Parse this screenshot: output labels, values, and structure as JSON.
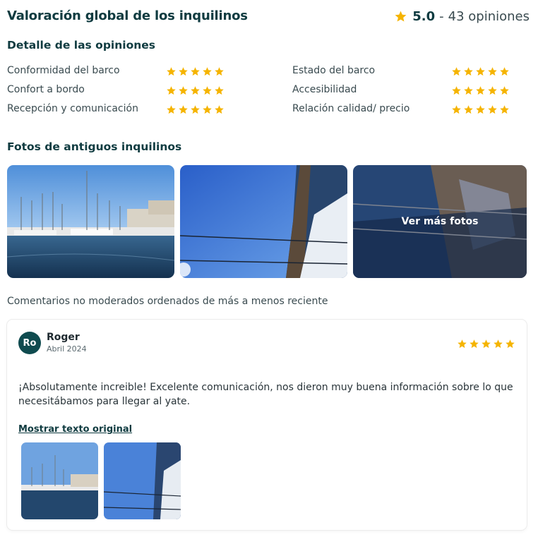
{
  "header": {
    "title": "Valoración global de los inquilinos",
    "score": "5.0",
    "separator": "-",
    "reviews_count": "43 opiniones",
    "star_color": "#f5b400"
  },
  "detail": {
    "title": "Detalle de las opiniones",
    "criteria": [
      {
        "label": "Conformidad del barco",
        "rating": 5,
        "max": 5
      },
      {
        "label": "Estado del barco",
        "rating": 5,
        "max": 5
      },
      {
        "label": "Confort a bordo",
        "rating": 5,
        "max": 5
      },
      {
        "label": "Accesibilidad",
        "rating": 5,
        "max": 5
      },
      {
        "label": "Recepción y comunicación",
        "rating": 5,
        "max": 5
      },
      {
        "label": "Relación calidad/ precio",
        "rating": 5,
        "max": 5
      }
    ]
  },
  "photos": {
    "title": "Fotos de antiguos inquilinos",
    "more_label": "Ver más fotos"
  },
  "comments": {
    "note": "Comentarios no moderados ordenados de más a menos reciente",
    "review": {
      "initials": "Ro",
      "name": "Roger",
      "date": "Abril 2024",
      "rating": 5,
      "text": "¡Absolutamente increible! Excelente comunicación, nos dieron muy buena información sobre lo que necesitábamos para llegar al yate.",
      "original_link": "Mostrar texto original"
    }
  },
  "colors": {
    "brand_dark": "#0f3b40",
    "avatar_bg": "#0f4b4f"
  }
}
